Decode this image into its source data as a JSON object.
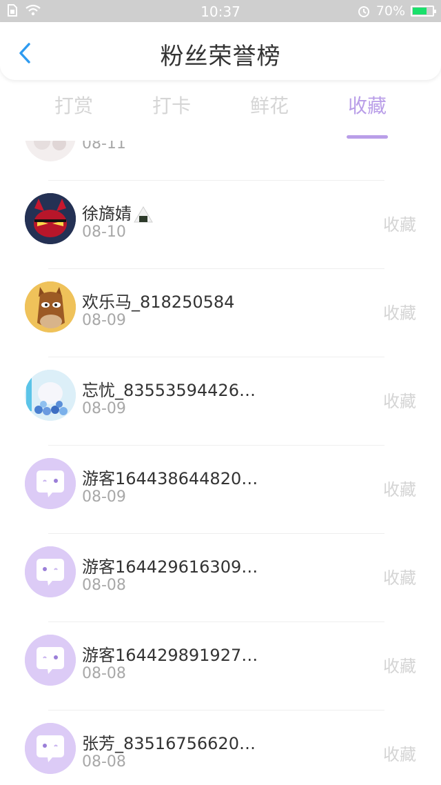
{
  "status_bar": {
    "time": "10:37",
    "battery_percent": "70%",
    "battery_level": 0.7,
    "icons": [
      "sim-icon",
      "wifi-icon",
      "alarm-icon",
      "battery-icon"
    ]
  },
  "header": {
    "title": "粉丝荣誉榜",
    "back_icon": "chevron-left-icon"
  },
  "tabs": [
    {
      "label": "打赏",
      "active": false
    },
    {
      "label": "打卡",
      "active": false
    },
    {
      "label": "鲜花",
      "active": false
    },
    {
      "label": "收藏",
      "active": true
    }
  ],
  "partial_row": {
    "date": "08-11"
  },
  "list": [
    {
      "name": "徐旖婧",
      "suffix_icon": "onigiri-emoji",
      "date": "08-10",
      "action": "收藏",
      "avatar": "cartoon-villain-avatar"
    },
    {
      "name": "欢乐马_818250584",
      "date": "08-09",
      "action": "收藏",
      "avatar": "cartoon-horse-avatar"
    },
    {
      "name": "忘忧_83553594426…",
      "date": "08-09",
      "action": "收藏",
      "avatar": "bubbles-avatar"
    },
    {
      "name": "游客164438644820…",
      "date": "08-09",
      "action": "收藏",
      "avatar": "default-chat-avatar"
    },
    {
      "name": "游客164429616309…",
      "date": "08-08",
      "action": "收藏",
      "avatar": "default-chat-avatar"
    },
    {
      "name": "游客164429891927…",
      "date": "08-08",
      "action": "收藏",
      "avatar": "default-chat-avatar"
    },
    {
      "name": "张芳_83516756620…",
      "date": "08-08",
      "action": "收藏",
      "avatar": "default-chat-avatar"
    }
  ],
  "colors": {
    "accent": "#b99ee8",
    "back_arrow": "#2e9bf0",
    "default_avatar_bg": "#d9c8f5"
  }
}
